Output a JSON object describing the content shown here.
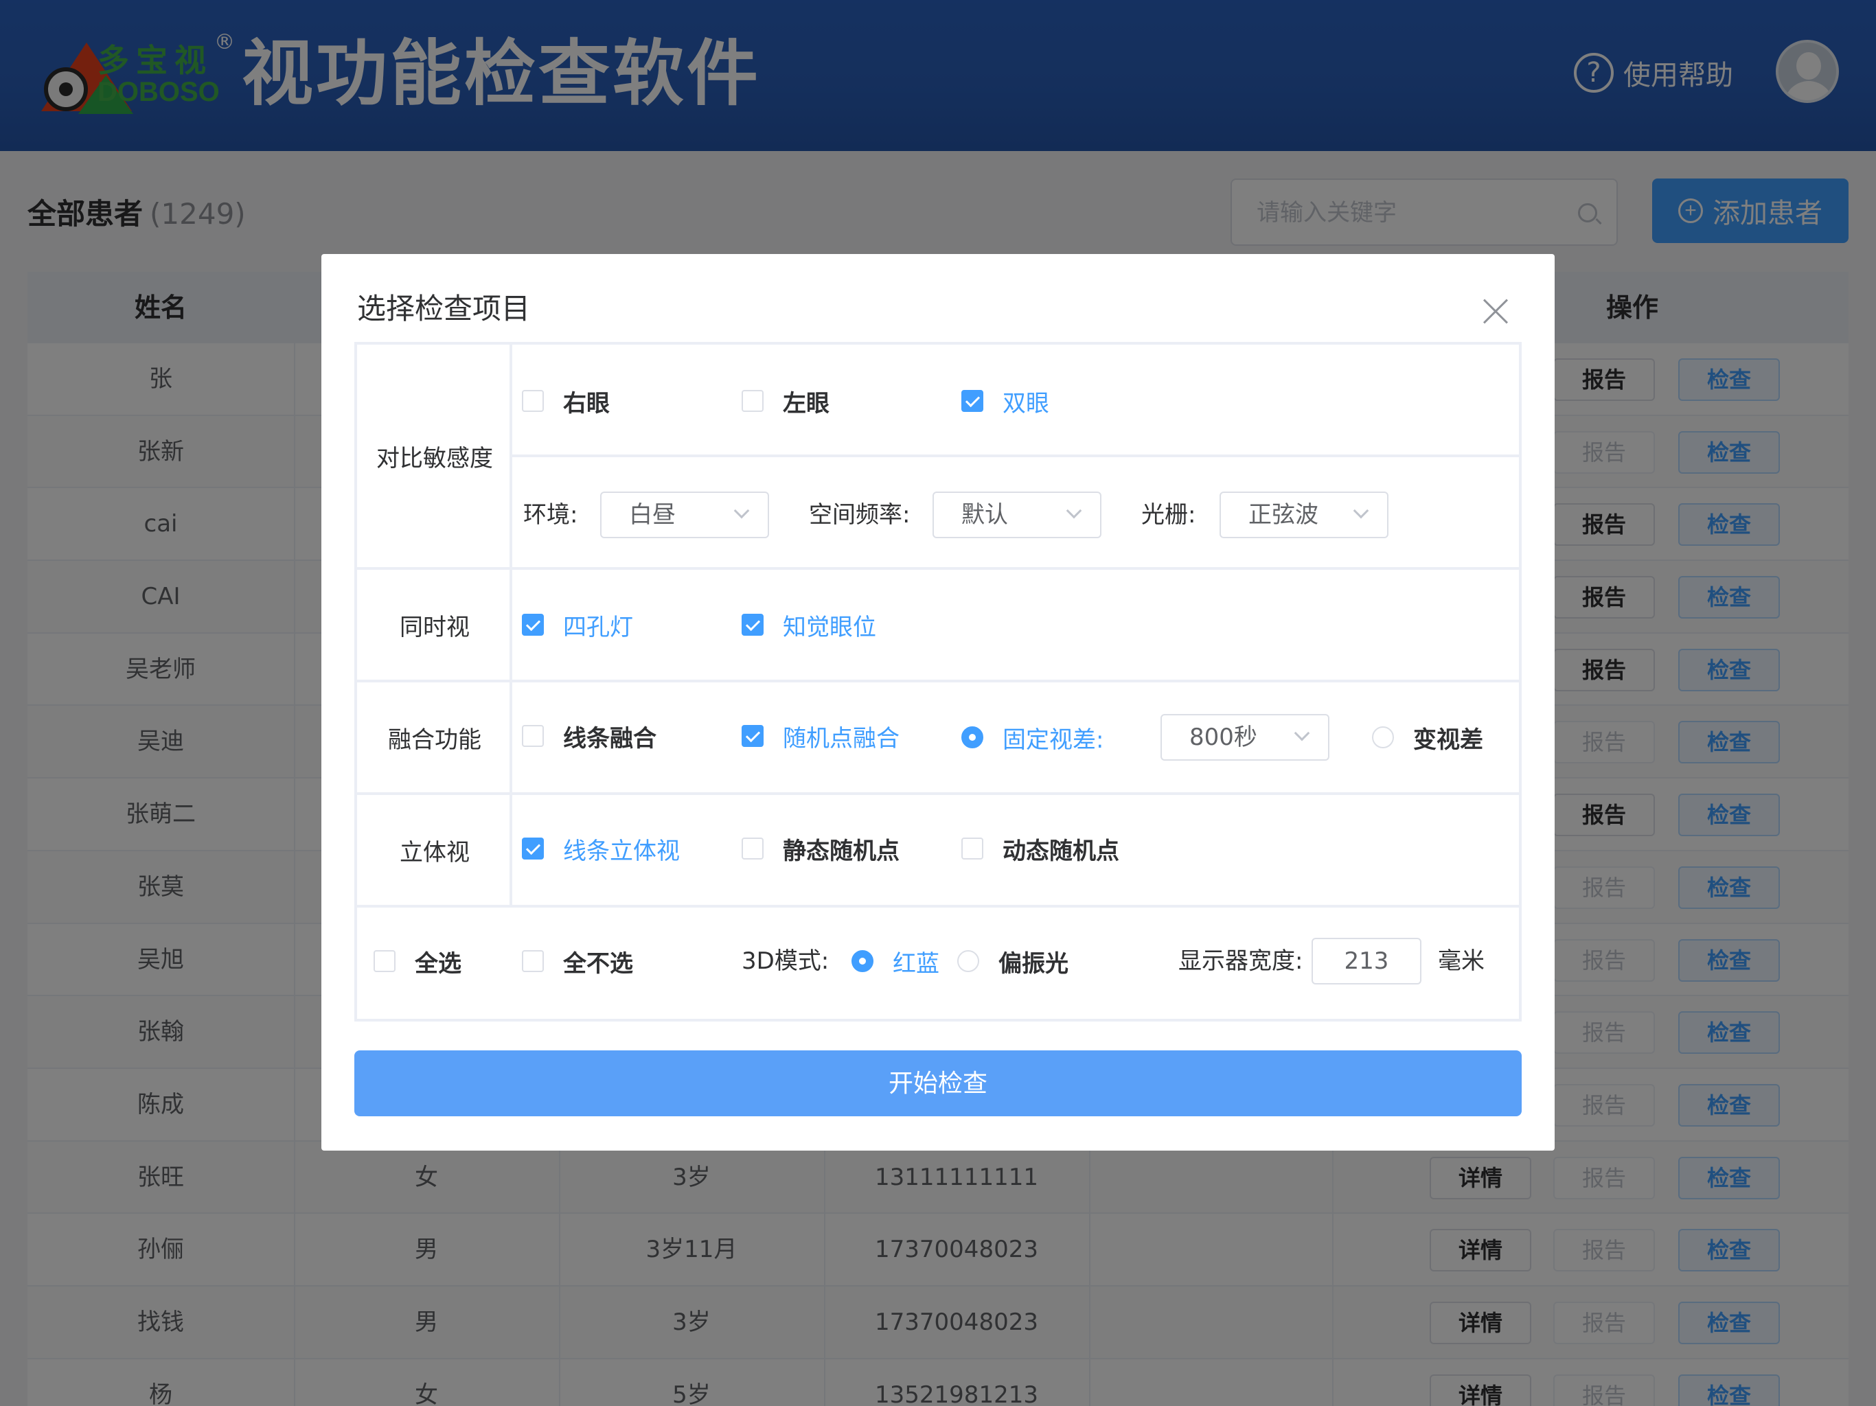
{
  "header": {
    "logo_cn": "多宝视",
    "logo_en": "DOBOSO",
    "logo_reg": "®",
    "title": "视功能检查软件",
    "help_icon": "?",
    "help_label": "使用帮助"
  },
  "page": {
    "title": "全部患者",
    "count": "(1249)",
    "search_placeholder": "请输入关键字",
    "add_icon": "+",
    "add_label": "添加患者"
  },
  "table": {
    "col_name": "姓名",
    "col_ops": "操作",
    "rows": [
      {
        "name": "张",
        "gender": "",
        "age": "",
        "phone": "",
        "details": "",
        "report": "报告",
        "report_enabled": true,
        "check": "检查"
      },
      {
        "name": "张新",
        "gender": "",
        "age": "",
        "phone": "",
        "details": "",
        "report": "报告",
        "report_enabled": false,
        "check": "检查"
      },
      {
        "name": "cai",
        "gender": "",
        "age": "",
        "phone": "",
        "details": "",
        "report": "报告",
        "report_enabled": true,
        "check": "检查"
      },
      {
        "name": "CAI",
        "gender": "",
        "age": "",
        "phone": "",
        "details": "",
        "report": "报告",
        "report_enabled": true,
        "check": "检查"
      },
      {
        "name": "吴老师",
        "gender": "",
        "age": "",
        "phone": "",
        "details": "",
        "report": "报告",
        "report_enabled": true,
        "check": "检查"
      },
      {
        "name": "吴迪",
        "gender": "",
        "age": "",
        "phone": "",
        "details": "",
        "report": "报告",
        "report_enabled": false,
        "check": "检查"
      },
      {
        "name": "张萌二",
        "gender": "",
        "age": "",
        "phone": "",
        "details": "",
        "report": "报告",
        "report_enabled": true,
        "check": "检查"
      },
      {
        "name": "张莫",
        "gender": "",
        "age": "",
        "phone": "",
        "details": "",
        "report": "报告",
        "report_enabled": false,
        "check": "检查"
      },
      {
        "name": "吴旭",
        "gender": "",
        "age": "",
        "phone": "",
        "details": "",
        "report": "报告",
        "report_enabled": false,
        "check": "检查"
      },
      {
        "name": "张翰",
        "gender": "",
        "age": "",
        "phone": "",
        "details": "",
        "report": "报告",
        "report_enabled": false,
        "check": "检查"
      },
      {
        "name": "陈成",
        "gender": "",
        "age": "",
        "phone": "",
        "details": "",
        "report": "报告",
        "report_enabled": false,
        "check": "检查"
      },
      {
        "name": "张旺",
        "gender": "女",
        "age": "3岁",
        "phone": "13111111111",
        "details": "详情",
        "report": "报告",
        "report_enabled": false,
        "check": "检查"
      },
      {
        "name": "孙俪",
        "gender": "男",
        "age": "3岁11月",
        "phone": "17370048023",
        "details": "详情",
        "report": "报告",
        "report_enabled": false,
        "check": "检查"
      },
      {
        "name": "找钱",
        "gender": "男",
        "age": "3岁",
        "phone": "17370048023",
        "details": "详情",
        "report": "报告",
        "report_enabled": false,
        "check": "检查"
      },
      {
        "name": "杨",
        "gender": "女",
        "age": "5岁",
        "phone": "13521981213",
        "details": "详情",
        "report": "报告",
        "report_enabled": false,
        "check": "检查"
      }
    ]
  },
  "dialog": {
    "title": "选择检查项目",
    "contrast": {
      "label": "对比敏感度",
      "right_eye": "右眼",
      "left_eye": "左眼",
      "both_eyes": "双眼",
      "env_label": "环境:",
      "env_value": "白昼",
      "freq_label": "空间频率:",
      "freq_value": "默认",
      "grating_label": "光栅:",
      "grating_value": "正弦波"
    },
    "simultaneous": {
      "label": "同时视",
      "four_dot": "四孔灯",
      "perceived_eye": "知觉眼位"
    },
    "fusion": {
      "label": "融合功能",
      "line_fusion": "线条融合",
      "random_dot_fusion": "随机点融合",
      "fixed_disparity": "固定视差:",
      "disparity_value": "800秒",
      "variable_disparity": "变视差"
    },
    "stereo": {
      "label": "立体视",
      "line_stereo": "线条立体视",
      "static_random": "静态随机点",
      "dynamic_random": "动态随机点"
    },
    "footer": {
      "select_all": "全选",
      "select_none": "全不选",
      "mode_label": "3D模式:",
      "red_blue": "红蓝",
      "polarized": "偏振光",
      "width_label": "显示器宽度:",
      "width_value": "213",
      "unit": "毫米"
    },
    "start": "开始检查"
  }
}
